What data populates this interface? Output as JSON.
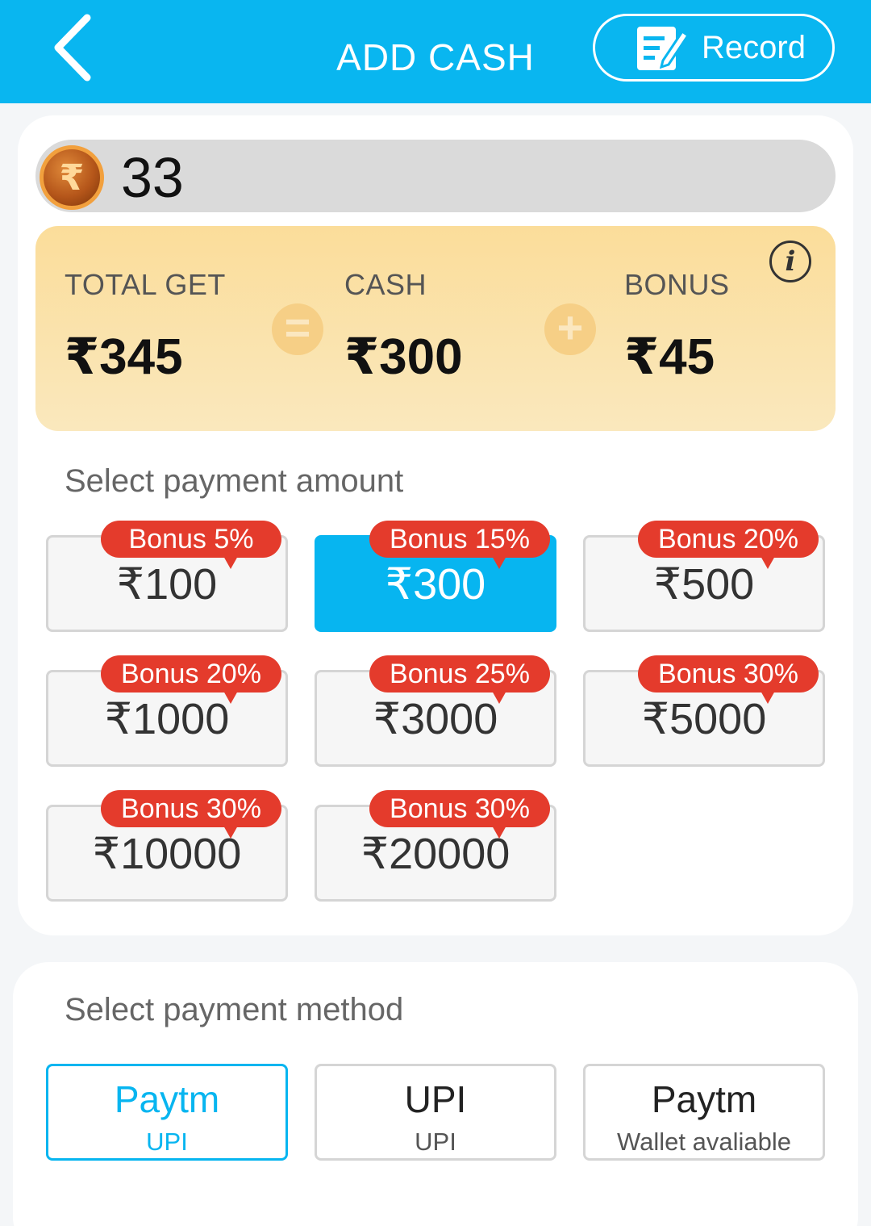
{
  "header": {
    "title": "ADD CASH",
    "record_label": "Record"
  },
  "balance": {
    "currency_symbol": "₹",
    "value": "33"
  },
  "summary": {
    "total_label": "TOTAL GET",
    "total_value": "₹345",
    "equals_symbol": "=",
    "cash_label": "CASH",
    "cash_value": "₹300",
    "plus_symbol": "+",
    "bonus_label": "BONUS",
    "bonus_value": "₹45",
    "info_symbol": "i"
  },
  "amount_section": {
    "title": "Select payment amount",
    "options": [
      {
        "amount": "₹100",
        "bonus": "Bonus 5%"
      },
      {
        "amount": "₹300",
        "bonus": "Bonus 15%"
      },
      {
        "amount": "₹500",
        "bonus": "Bonus 20%"
      },
      {
        "amount": "₹1000",
        "bonus": "Bonus 20%"
      },
      {
        "amount": "₹3000",
        "bonus": "Bonus 25%"
      },
      {
        "amount": "₹5000",
        "bonus": "Bonus 30%"
      },
      {
        "amount": "₹10000",
        "bonus": "Bonus 30%"
      },
      {
        "amount": "₹20000",
        "bonus": "Bonus 30%"
      }
    ],
    "selected": "₹300"
  },
  "method_section": {
    "title": "Select payment method",
    "methods": [
      {
        "name": "Paytm",
        "sub": "UPI"
      },
      {
        "name": "UPI",
        "sub": "UPI"
      },
      {
        "name": "Paytm",
        "sub": "Wallet avaliable"
      }
    ],
    "selected": "Paytm UPI"
  },
  "colors": {
    "primary": "#09b6f0",
    "badge": "#e43b2c",
    "summary_bg": "#fbdd9a"
  },
  "icons": {
    "back": "chevron-left-icon",
    "record": "edit-document-icon",
    "coin": "rupee-coin-icon",
    "info": "info-icon"
  }
}
